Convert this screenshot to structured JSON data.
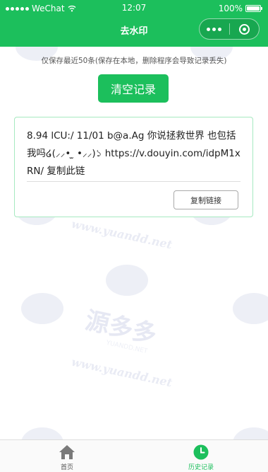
{
  "status_bar": {
    "carrier": "WeChat",
    "time": "12:07",
    "battery": "100%"
  },
  "nav": {
    "title": "去水印"
  },
  "notice": "仅保存最近50条(保存在本地，删除程序会导致记录丢失)",
  "clear_button_label": "清空记录",
  "records": [
    {
      "text": "8.94 lCU:/ 11/01 b@a.Ag 你说拯救世界 也包括我吗໒(⸝⸝• ̫ •⸝⸝)১ https://v.douyin.com/idpM1xRN/ 复制此链",
      "copy_label": "复制链接"
    }
  ],
  "watermark": {
    "brand": "源多多",
    "latin": "YUANDD.NET",
    "url": "www.yuandd.net"
  },
  "tab_bar": {
    "items": [
      {
        "label": "首页",
        "icon": "home-icon",
        "active": false
      },
      {
        "label": "历史记录",
        "icon": "clock-icon",
        "active": true
      }
    ]
  },
  "colors": {
    "brand_green": "#1cbf5c",
    "card_border": "#a6e9c0"
  }
}
